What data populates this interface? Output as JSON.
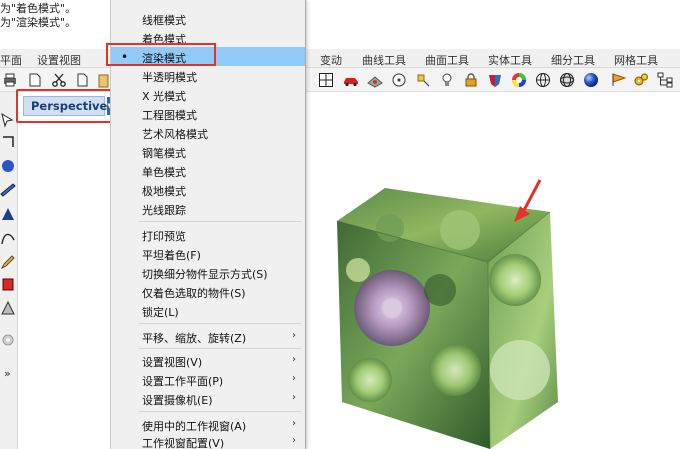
{
  "instructions": {
    "line1": "为\"着色模式\"。",
    "line2": "为\"渲染模式\"。"
  },
  "tabs": [
    {
      "label": "平面"
    },
    {
      "label": "设置视图"
    },
    {
      "label": "变动"
    },
    {
      "label": "曲线工具"
    },
    {
      "label": "曲面工具"
    },
    {
      "label": "实体工具"
    },
    {
      "label": "细分工具"
    },
    {
      "label": "网格工具"
    }
  ],
  "viewport": {
    "title": "Perspective",
    "dropdown_icon": "triangle-down-icon"
  },
  "left_toolbar": {
    "expand_label": "»"
  },
  "menu": {
    "display_modes": [
      {
        "label": "线框模式"
      },
      {
        "label": "着色模式"
      },
      {
        "label": "渲染模式",
        "selected": true
      },
      {
        "label": "半透明模式"
      },
      {
        "label": "X 光模式"
      },
      {
        "label": "工程图模式"
      },
      {
        "label": "艺术风格模式"
      },
      {
        "label": "钢笔模式"
      },
      {
        "label": "单色模式"
      },
      {
        "label": "极地模式"
      },
      {
        "label": "光线跟踪"
      }
    ],
    "actions": [
      {
        "label": "打印预览"
      },
      {
        "label": "平坦着色(F)"
      },
      {
        "label": "切换细分物件显示方式(S)"
      },
      {
        "label": "仅着色选取的物件(S)"
      },
      {
        "label": "锁定(L)"
      }
    ],
    "nav": [
      {
        "label": "平移、缩放、旋转(Z)",
        "submenu": true
      }
    ],
    "setup": [
      {
        "label": "设置视图(V)",
        "submenu": true
      },
      {
        "label": "设置工作平面(P)",
        "submenu": true
      },
      {
        "label": "设置摄像机(E)",
        "submenu": true
      }
    ],
    "workspace": [
      {
        "label": "使用中的工作视窗(A)",
        "submenu": true
      },
      {
        "label": "工作视窗配置(V)",
        "submenu": true
      }
    ],
    "submenu_arrow": "›",
    "selected_bullet": "•"
  },
  "colors": {
    "menu_bg": "#f0f0f0",
    "selected_bg": "#91c9f7",
    "highlight_red": "#e2332b",
    "persp_bg": "#cfe0f3"
  }
}
